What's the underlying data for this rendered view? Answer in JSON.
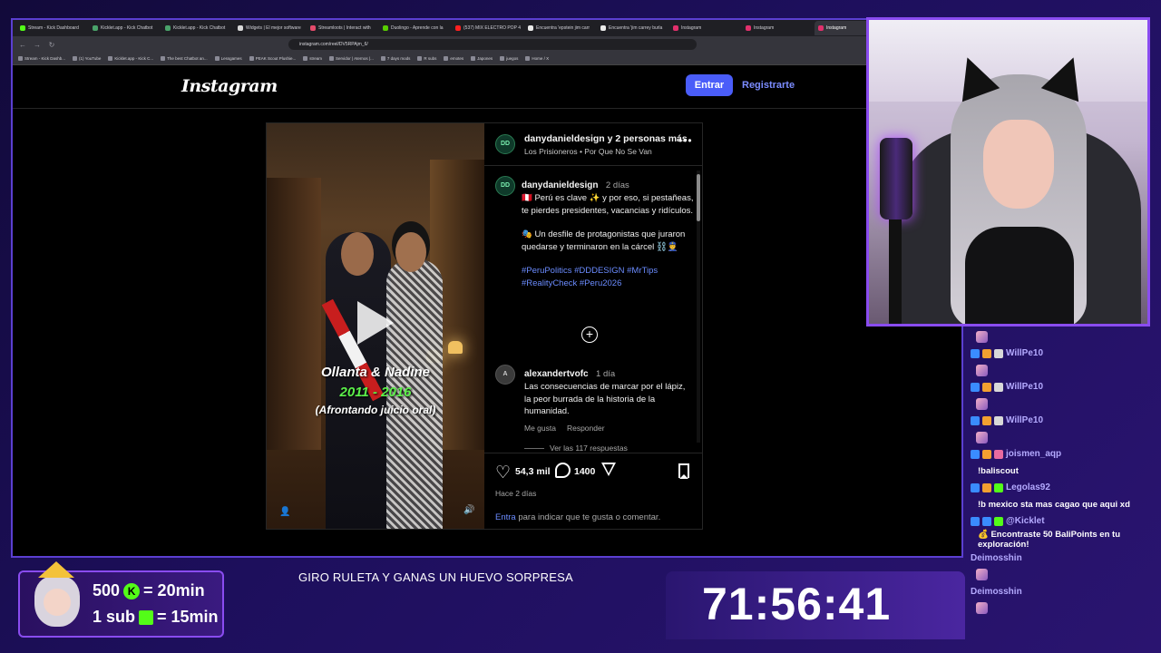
{
  "browser": {
    "tabs": [
      {
        "label": "Stream - Kick Dashboard",
        "color": "#53fc18"
      },
      {
        "label": "Kicklet.app - Kick Chatbot",
        "color": "#4aa36a"
      },
      {
        "label": "Kicklet.app - Kick Chatbot",
        "color": "#4aa36a"
      },
      {
        "label": "Widgets | El mejor software",
        "color": "#d8d8d8"
      },
      {
        "label": "Streamloots | Interact with",
        "color": "#e44b6b"
      },
      {
        "label": "Duolingo - Aprende con la",
        "color": "#58cc02"
      },
      {
        "label": "(537) MIX ELECTRO POP 4",
        "color": "#ff2020"
      },
      {
        "label": "Encuentra 'epstein jim carr",
        "color": "#eaeaea"
      },
      {
        "label": "Encuentra 'jim carrey burla",
        "color": "#eaeaea"
      },
      {
        "label": "Instagram",
        "color": "#e1306c"
      },
      {
        "label": "Instagram",
        "color": "#e1306c"
      },
      {
        "label": "Instagram",
        "color": "#e1306c"
      }
    ],
    "url": "instagram.com/reel/DV5RPAjm_6/",
    "bookmarks": [
      "Stream - Kick Dashb...",
      "(1) YouTube",
      "Kicklet.app - Kick C...",
      "The best Chatbot an...",
      "Lessgames",
      "PEAK Scout Plushie...",
      "stream",
      "Servidor | Aternos |...",
      "7 days mods",
      "R subs",
      "emotes",
      "Japones",
      "juegos",
      "Home / X"
    ]
  },
  "instagram": {
    "logo": "Instagram",
    "login_label": "Entrar",
    "signup_label": "Registrarte",
    "post": {
      "author": "danydanieldesign y 2 personas más",
      "audio": "Los Prisioneros • Por Que No Se Van",
      "overlay_title": "Ollanta & Nadine",
      "overlay_years": "2011 - 2016",
      "overlay_sub": "(Afrontando juicio oral)",
      "caption_user": "danydanieldesign",
      "caption_time": "2 días",
      "caption_p1": "🇵🇪 Perú es clave ✨ y por eso, si pestañeas, te pierdes presidentes, vacancias y ridículos.",
      "caption_p2": "🎭 Un desfile de protagonistas que juraron quedarse y terminaron en la cárcel ⛓️👮",
      "hashtags": "#PeruPolitics #DDDESIGN #MrTips #RealityCheck #Peru2026",
      "comment_user": "alexandertvofc",
      "comment_time": "1 día",
      "comment_text": "Las consecuencias de marcar por el lápiz, la peor burrada de la historia de la humanidad.",
      "comment_like": "Me gusta",
      "comment_reply": "Responder",
      "view_replies": "Ver las 117 respuestas",
      "likes": "54,3 mil",
      "comments": "1400",
      "date": "Hace 2 días",
      "prompt_link": "Entra",
      "prompt_rest": " para indicar que te gusta o comentar."
    }
  },
  "chat": [
    {
      "type": "emote"
    },
    {
      "type": "user",
      "name": "WillPe10",
      "badges": [
        "#3a8cff",
        "#f3a030",
        "#d8d8d8"
      ]
    },
    {
      "type": "emote"
    },
    {
      "type": "user",
      "name": "WillPe10",
      "badges": [
        "#3a8cff",
        "#f3a030",
        "#d8d8d8"
      ]
    },
    {
      "type": "emote"
    },
    {
      "type": "user",
      "name": "WillPe10",
      "badges": [
        "#3a8cff",
        "#f3a030",
        "#d8d8d8"
      ]
    },
    {
      "type": "emote"
    },
    {
      "type": "user",
      "name": "joismen_aqp",
      "badges": [
        "#3a8cff",
        "#f3a030",
        "#e86aa0"
      ]
    },
    {
      "type": "msg",
      "text": "!baliscout"
    },
    {
      "type": "user",
      "name": "Legolas92",
      "badges": [
        "#3a8cff",
        "#f3a030",
        "#53fc18"
      ]
    },
    {
      "type": "msg",
      "text": "!b mexico sta mas cagao que aqui xd"
    },
    {
      "type": "user",
      "name": "@Kicklet",
      "badges": [
        "#3a8cff",
        "#3a8cff",
        "#53fc18"
      ]
    },
    {
      "type": "msg",
      "text": "💰 Encontraste 50 BaliPoints en tu exploración!"
    },
    {
      "type": "user",
      "name": "Deimosshin",
      "badges": []
    },
    {
      "type": "emote"
    },
    {
      "type": "user",
      "name": "Deimosshin",
      "badges": []
    },
    {
      "type": "emote"
    }
  ],
  "overlay": {
    "goal1_amount": "500",
    "goal1_value": "= 20min",
    "goal2_amount": "1 sub",
    "goal2_value": "= 15min",
    "marquee": "GIRO RULETA Y GANAS UN HUEVO SORPRESA",
    "timer": "71:56:41",
    "kick_glyph": "K"
  },
  "colors": {
    "accent_purple": "#8a4cf0",
    "instagram_blue": "#4a5df9",
    "kick_green": "#53fc18"
  }
}
